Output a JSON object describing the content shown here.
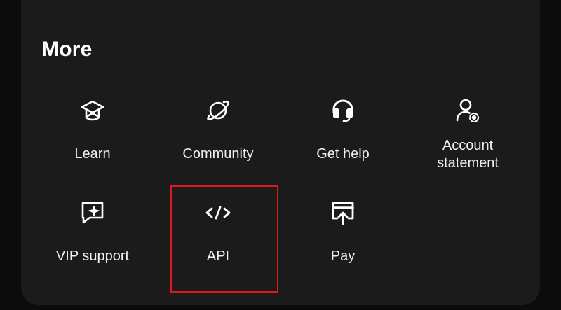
{
  "section": {
    "title": "More"
  },
  "items": [
    {
      "label": "Learn",
      "icon": "graduation-cap-icon"
    },
    {
      "label": "Community",
      "icon": "planet-icon"
    },
    {
      "label": "Get help",
      "icon": "headset-icon"
    },
    {
      "label": "Account\nstatement",
      "icon": "user-gear-icon"
    },
    {
      "label": "VIP support",
      "icon": "vip-chat-icon"
    },
    {
      "label": "API",
      "icon": "code-icon"
    },
    {
      "label": "Pay",
      "icon": "payment-terminal-icon"
    }
  ],
  "highlight": {
    "target": "API",
    "color": "#e0181b"
  },
  "colors": {
    "panel": "#1b1b1b",
    "background": "#0c0c0c",
    "text": "#f2f2f2"
  }
}
